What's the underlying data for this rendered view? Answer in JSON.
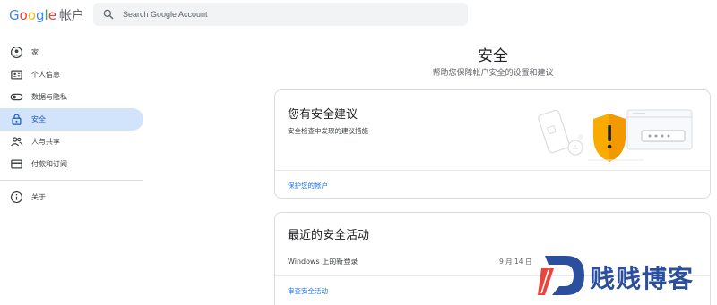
{
  "header": {
    "logo_letters": [
      "G",
      "o",
      "o",
      "g",
      "l",
      "e"
    ],
    "product": "帐户",
    "search_placeholder": "Search Google Account"
  },
  "sidebar": {
    "items": [
      {
        "label": "家",
        "icon": "person-circle-icon",
        "active": false
      },
      {
        "label": "个人信息",
        "icon": "id-card-icon",
        "active": false
      },
      {
        "label": "数据与隐私",
        "icon": "toggle-icon",
        "active": false
      },
      {
        "label": "安全",
        "icon": "lock-icon",
        "active": true
      },
      {
        "label": "人与共享",
        "icon": "people-icon",
        "active": false
      },
      {
        "label": "付款和订阅",
        "icon": "credit-card-icon",
        "active": false
      }
    ],
    "about": {
      "label": "关于",
      "icon": "info-icon"
    }
  },
  "main": {
    "title": "安全",
    "subtitle": "帮助您保障帐户安全的设置和建议"
  },
  "recommendations_card": {
    "title": "您有安全建议",
    "description": "安全检查中发现的建议措施",
    "link": "保护您的帐户",
    "illustration": "shield-warning-illustration"
  },
  "activity_card": {
    "title": "最近的安全活动",
    "items": [
      {
        "event": "Windows 上的新登录",
        "date": "9 月 14 日"
      }
    ],
    "link": "审查安全活动"
  },
  "watermark": {
    "text": "贱贱博客",
    "logo_letter": "D"
  },
  "colors": {
    "accent_blue": "#1a73e8",
    "active_nav_bg": "#d2e3fc",
    "shield_warning": "#f9ab00",
    "watermark_blue": "#2b4f9c"
  }
}
